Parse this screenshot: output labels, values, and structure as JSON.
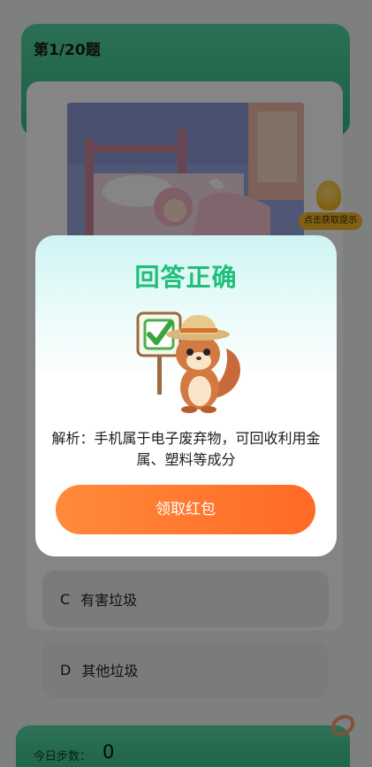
{
  "quiz": {
    "progress": "第1/20题",
    "hint_label": "点击获取提示",
    "options": [
      {
        "letter": "C",
        "text": "有害垃圾"
      },
      {
        "letter": "D",
        "text": "其他垃圾"
      }
    ]
  },
  "steps": {
    "label": "今日步数：",
    "value": "0"
  },
  "modal": {
    "title": "回答正确",
    "explanation": "解析：手机属于电子废弃物，可回收利用金属、塑料等成分",
    "claim_button": "领取红包"
  },
  "colors": {
    "accent_green": "#1fbf7a",
    "button_orange": "#ff6a26",
    "header_green": "#34be8b"
  },
  "icons": {
    "hint": "lightbulb-icon",
    "mascot": "squirrel-checkmark-sign-illustration"
  }
}
